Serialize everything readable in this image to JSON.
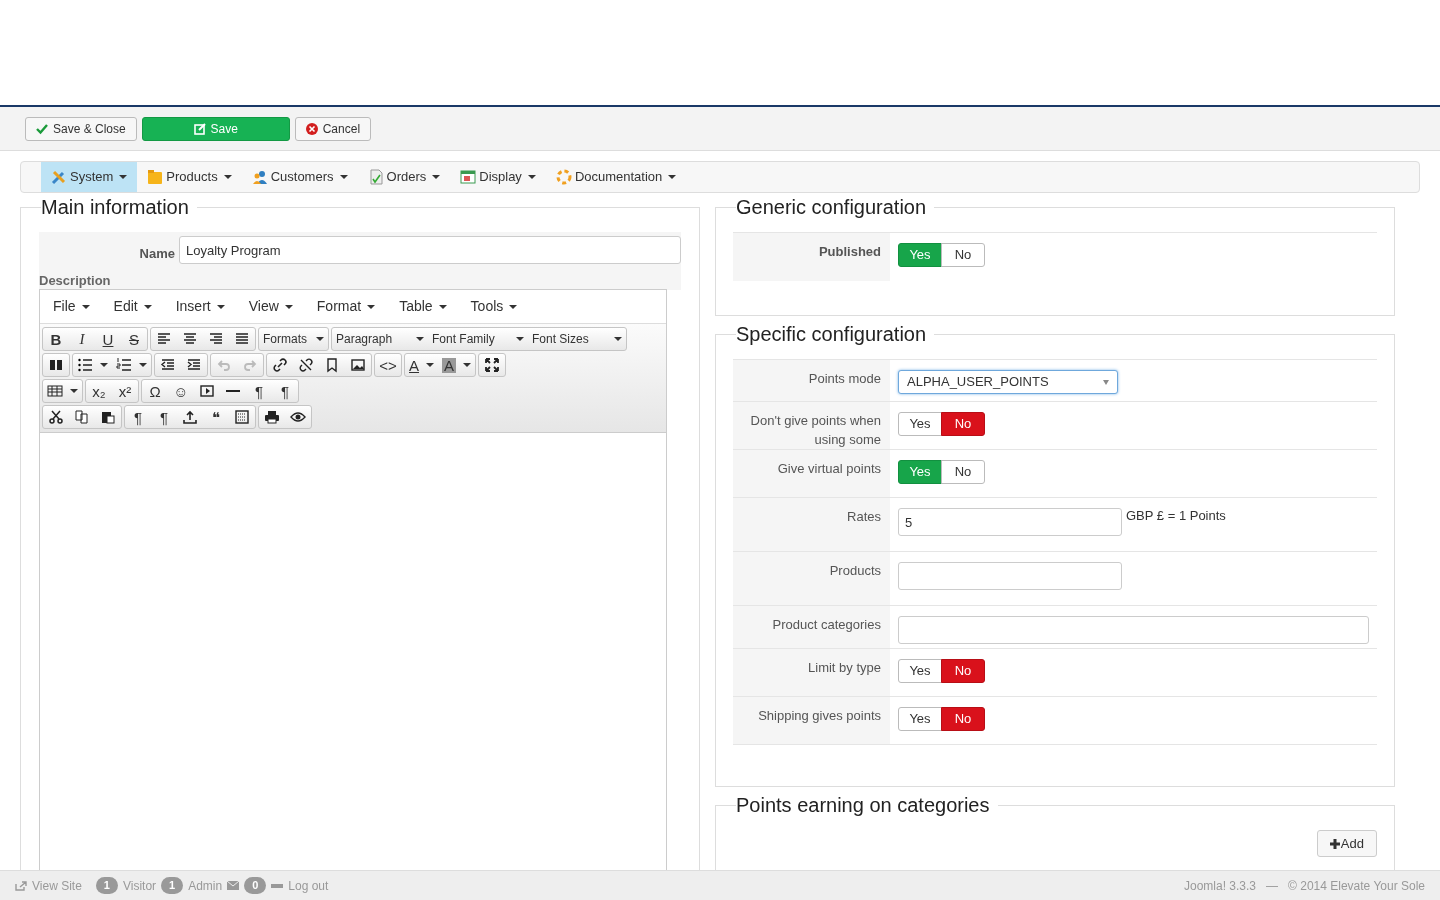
{
  "toolbar": [
    {
      "kind": "check",
      "label": "Save & Close"
    },
    {
      "kind": "save",
      "label": "Save"
    },
    {
      "kind": "cancel",
      "label": "Cancel"
    }
  ],
  "menu": [
    {
      "label": "System",
      "selected": true
    },
    {
      "label": "Products",
      "selected": false
    },
    {
      "label": "Customers",
      "selected": false
    },
    {
      "label": "Orders",
      "selected": false
    },
    {
      "label": "Display",
      "selected": false
    },
    {
      "label": "Documentation",
      "selected": false
    }
  ],
  "main_information": {
    "title": "Main information",
    "name_label": "Name",
    "name_value": "Loyalty Program",
    "description_label": "Description",
    "editor": {
      "menus": [
        "File",
        "Edit",
        "Insert",
        "View",
        "Format",
        "Table",
        "Tools"
      ],
      "glyphs": [
        "B",
        "I",
        "U",
        "S",
        "<>",
        "A",
        "A",
        "x₂",
        "x²",
        "Ω",
        "☺",
        "¶",
        "¶",
        "¶",
        "¶",
        "❝"
      ],
      "dropdowns": [
        "Formats",
        "Paragraph",
        "Font Family",
        "Font Sizes"
      ]
    }
  },
  "generic_configuration": {
    "title": "Generic configuration",
    "fields": [
      {
        "kind": "toggle",
        "label": "Published",
        "options": [
          {
            "label": "Yes",
            "selected": true
          },
          {
            "label": "No",
            "selected": false
          }
        ]
      }
    ]
  },
  "specific_configuration": {
    "title": "Specific configuration",
    "fields": [
      {
        "kind": "select",
        "label": "Points mode",
        "value": "ALPHA_USER_POINTS"
      },
      {
        "kind": "toggle",
        "label": "Don't give points when using some",
        "options": [
          {
            "label": "Yes",
            "selected": false
          },
          {
            "label": "No",
            "selected": true
          }
        ]
      },
      {
        "kind": "toggle",
        "label": "Give virtual points",
        "options": [
          {
            "label": "Yes",
            "selected": true
          },
          {
            "label": "No",
            "selected": false
          }
        ]
      },
      {
        "kind": "text",
        "label": "Rates",
        "value": "5",
        "suffix": "GBP £ = 1 Points"
      },
      {
        "kind": "text",
        "label": "Products"
      },
      {
        "kind": "wide",
        "label": "Product categories"
      },
      {
        "kind": "toggle",
        "label": "Limit by type",
        "options": [
          {
            "label": "Yes",
            "selected": false
          },
          {
            "label": "No",
            "selected": true
          }
        ]
      },
      {
        "kind": "toggle",
        "label": "Shipping gives points",
        "options": [
          {
            "label": "Yes",
            "selected": false
          },
          {
            "label": "No",
            "selected": true
          }
        ]
      }
    ]
  },
  "points_earning": {
    "title": "Points earning on categories",
    "add_label": "Add"
  },
  "footer": {
    "view_site": "View Site",
    "visitor_count": "1",
    "visitor": "Visitor",
    "admin_count": "1",
    "admin": "Admin",
    "messages_count": "0",
    "logout": "Log out",
    "version": "Joomla! 3.3.3",
    "separator": "—",
    "copyright": "© 2014 Elevate Your Sole"
  }
}
